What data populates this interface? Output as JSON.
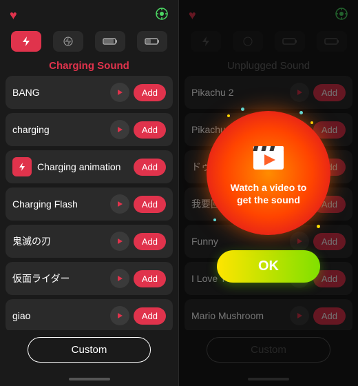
{
  "left": {
    "heart_icon": "♥",
    "location_icon": "⊕",
    "tabs": [
      {
        "icon": "⚡",
        "active": true
      },
      {
        "icon": "⚡",
        "active": false
      },
      {
        "icon": "▬",
        "active": false
      },
      {
        "icon": "▮",
        "active": false
      }
    ],
    "section_title": "Charging Sound",
    "items": [
      {
        "name": "BANG",
        "has_icon": false,
        "icon_char": ""
      },
      {
        "name": "charging",
        "has_icon": false,
        "icon_char": ""
      },
      {
        "name": "Charging animation",
        "has_icon": true,
        "icon_char": "⚡"
      },
      {
        "name": "Charging Flash",
        "has_icon": false,
        "icon_char": ""
      },
      {
        "name": "鬼滅の刃",
        "has_icon": false,
        "icon_char": ""
      },
      {
        "name": "仮面ライダー",
        "has_icon": false,
        "icon_char": ""
      },
      {
        "name": "giao",
        "has_icon": false,
        "icon_char": ""
      }
    ],
    "add_label": "Add",
    "custom_label": "Custom"
  },
  "right": {
    "heart_icon": "♥",
    "location_icon": "⊕",
    "section_title": "Unplugged Sound",
    "items": [
      {
        "name": "Pikachu 2"
      },
      {
        "name": "Pikachu 3"
      },
      {
        "name": "ドゥトゥル",
        "partial": true
      },
      {
        "name": "我要回",
        "partial": true
      },
      {
        "name": "Funny",
        "partial": true
      },
      {
        "name": "I Love You 3000"
      },
      {
        "name": "Mario Mushroom"
      }
    ],
    "add_label": "Add",
    "custom_label": "Custom",
    "modal": {
      "title": "Watch a video to",
      "subtitle": "get the sound",
      "ok_label": "OK"
    }
  }
}
